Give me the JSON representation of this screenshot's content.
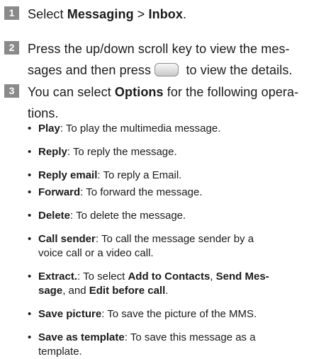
{
  "steps": [
    {
      "number": "1",
      "pre": "Select ",
      "b1": "Messaging",
      "mid": " > ",
      "b2": "Inbox",
      "post": "."
    },
    {
      "number": "2",
      "line1": "Press the up/down scroll key to view the mes-",
      "line2a": "sages and then press",
      "line2b": "to view the details.",
      "key_icon": "center-select-key-icon"
    },
    {
      "number": "3",
      "pre": "You can select ",
      "b1": "Options",
      "post": " for the following opera-",
      "line2": "tions."
    }
  ],
  "bullets": [
    {
      "term": "Play",
      "desc": ": To play the multimedia message."
    },
    {
      "term": "Reply",
      "desc": ": To reply the message."
    },
    {
      "term": "Reply email",
      "desc": ": To reply a Email."
    },
    {
      "term": "Forward",
      "desc": ": To forward the message."
    },
    {
      "term": "Delete",
      "desc": ": To delete the message."
    },
    {
      "term": "Call sender",
      "desc": ": To call the message sender by a",
      "line2": "voice call or a video call."
    },
    {
      "term": "Extract.",
      "desc": ": To select ",
      "b1": "Add to Contacts",
      "sep1": ", ",
      "b2": "Send Mes-",
      "line2_b": "sage",
      "line2_mid": ", and ",
      "line2_b2": "Edit before call",
      "line2_end": "."
    },
    {
      "term": "Save picture",
      "desc": ": To save the picture of the MMS."
    },
    {
      "term": "Save as template",
      "desc": ": To save this message as a",
      "line2": "template."
    }
  ]
}
